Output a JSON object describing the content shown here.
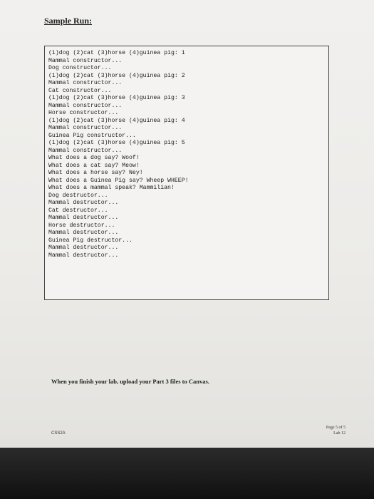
{
  "heading": "Sample Run:",
  "console_lines": [
    "(1)dog (2)cat (3)horse (4)guinea pig: 1",
    "Mammal constructor...",
    "Dog constructor...",
    "(1)dog (2)cat (3)horse (4)guinea pig: 2",
    "Mammal constructor...",
    "Cat constructor...",
    "(1)dog (2)cat (3)horse (4)guinea pig: 3",
    "Mammal constructor...",
    "Horse constructor...",
    "(1)dog (2)cat (3)horse (4)guinea pig: 4",
    "Mammal constructor...",
    "Guinea Pig constructor...",
    "(1)dog (2)cat (3)horse (4)guinea pig: 5",
    "Mammal constructor...",
    "What does a dog say? Woof!",
    "What does a cat say? Meow!",
    "What does a horse say? Ney!",
    "What does a Guinea Pig say? Wheep WHEEP!",
    "What does a mammal speak? Mammilian!",
    "Dog destructor...",
    "Mammal destructor...",
    "Cat destructor...",
    "Mammal destructor...",
    "Horse destructor...",
    "Mammal destructor...",
    "Guinea Pig destructor...",
    "Mammal destructor...",
    "Mammal destructor..."
  ],
  "instruction": "When you finish your lab, upload your Part 3 files to Canvas.",
  "course": "CSS2A",
  "page_number": "Page 5 of 5",
  "lab_label": "Lab 12"
}
